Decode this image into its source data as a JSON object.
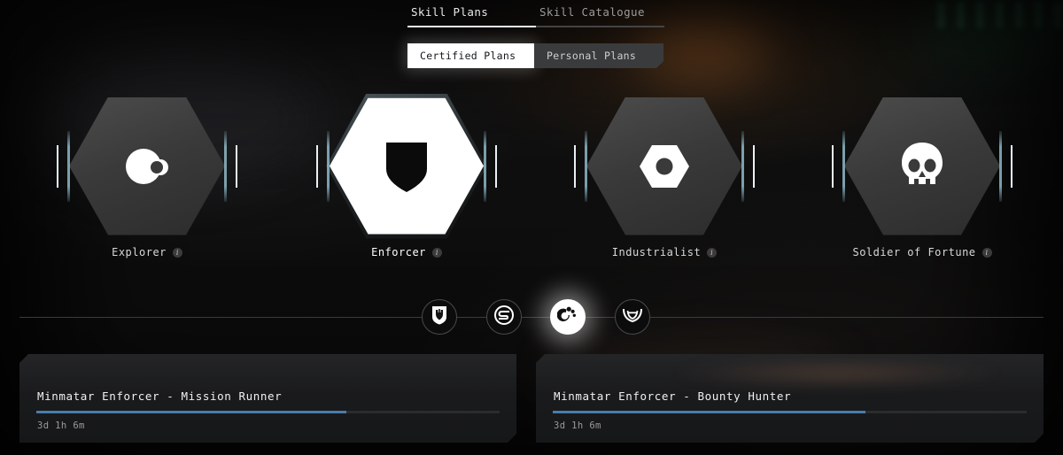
{
  "tabs": {
    "items": [
      {
        "label": "Skill Plans",
        "active": true
      },
      {
        "label": "Skill Catalogue",
        "active": false
      }
    ]
  },
  "subtabs": {
    "items": [
      {
        "label": "Certified Plans",
        "selected": true
      },
      {
        "label": "Personal Plans",
        "selected": false
      }
    ]
  },
  "career_cards": [
    {
      "label": "Explorer",
      "icon": "planet-moon-icon",
      "selected": false,
      "info": "i"
    },
    {
      "label": "Enforcer",
      "icon": "shield-icon",
      "selected": true,
      "info": "i"
    },
    {
      "label": "Industrialist",
      "icon": "hex-nut-icon",
      "selected": false,
      "info": "i"
    },
    {
      "label": "Soldier of Fortune",
      "icon": "skull-icon",
      "selected": false,
      "info": "i"
    }
  ],
  "factions": [
    {
      "name": "Amarr",
      "icon": "amarr-crest-icon",
      "selected": false
    },
    {
      "name": "Caldari",
      "icon": "caldari-crest-icon",
      "selected": false
    },
    {
      "name": "Minmatar",
      "icon": "minmatar-crest-icon",
      "selected": true
    },
    {
      "name": "Gallente",
      "icon": "gallente-crest-icon",
      "selected": false
    }
  ],
  "plans": [
    {
      "title": "Minmatar Enforcer - Mission Runner",
      "time": "3d 1h 6m",
      "progress": 67
    },
    {
      "title": "Minmatar Enforcer - Bounty Hunter",
      "time": "3d 1h 6m",
      "progress": 66
    }
  ],
  "colors": {
    "accent_progress": "#4a7cab",
    "selected_white": "#ffffff",
    "bracket_teal": "#96c3d2",
    "background": "#0a0a0a"
  }
}
